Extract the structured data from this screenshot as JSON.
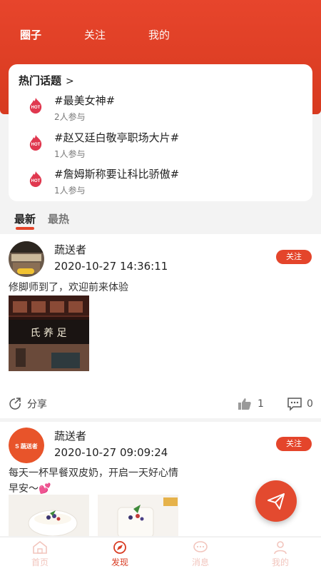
{
  "header": {
    "tabs": [
      {
        "label": "圈子"
      },
      {
        "label": "关注"
      },
      {
        "label": "我的"
      }
    ]
  },
  "hot_topics": {
    "title": "热门话题",
    "chevron": ">",
    "items": [
      {
        "name": "#最美女神#",
        "participants": "2人参与"
      },
      {
        "name": "#赵又廷白敬亭职场大片#",
        "participants": "1人参与"
      },
      {
        "name": "#詹姆斯称要让科比骄傲#",
        "participants": "1人参与"
      }
    ],
    "badge": "HOT"
  },
  "feed_tabs": {
    "latest": "最新",
    "hottest": "最热"
  },
  "posts": [
    {
      "username": "蔬送者",
      "time": "2020-10-27 14:36:11",
      "follow_label": "关注",
      "text": "修脚师到了，欢迎前来体验",
      "image_sign_text": "氏 养 足",
      "share_label": "分享",
      "likes": "1",
      "comments": "0"
    },
    {
      "username": "蔬送者",
      "time": "2020-10-27 09:09:24",
      "follow_label": "关注",
      "text_line1": "每天一杯早餐双皮奶，开启一天好心情",
      "text_line2": "早安～💕",
      "avatar_logo": "S 蔬送者"
    }
  ],
  "bottom_nav": {
    "items": [
      {
        "label": "首页"
      },
      {
        "label": "发现"
      },
      {
        "label": "消息"
      },
      {
        "label": "我的"
      }
    ]
  },
  "colors": {
    "accent": "#e4452b",
    "nav_active": "#d83b22",
    "nav_inactive": "#f2c5bd"
  }
}
